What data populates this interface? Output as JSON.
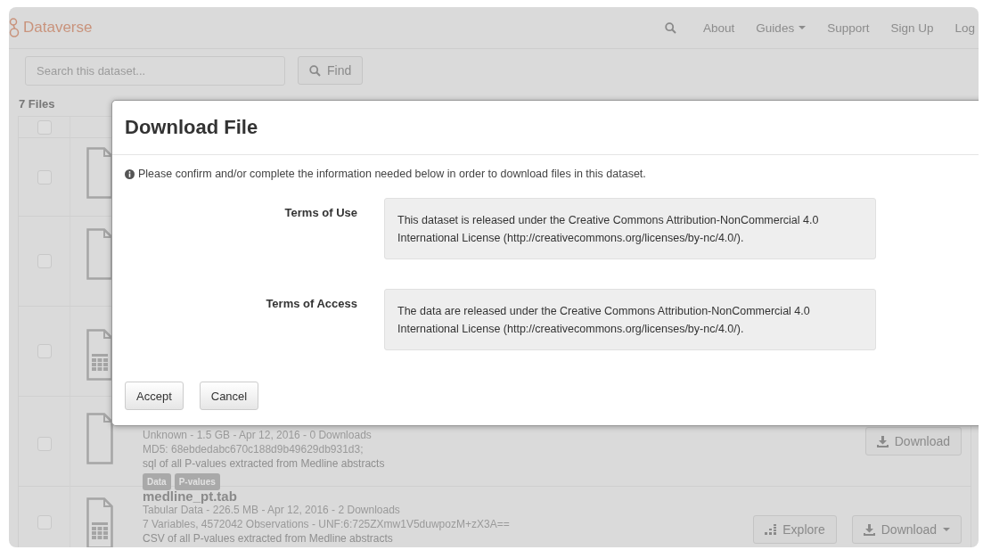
{
  "navbar": {
    "brand": "Dataverse",
    "links": [
      {
        "label": "About",
        "dropdown": false
      },
      {
        "label": "Guides",
        "dropdown": true
      },
      {
        "label": "Support",
        "dropdown": false
      },
      {
        "label": "Sign Up",
        "dropdown": false
      },
      {
        "label": "Log",
        "dropdown": false
      }
    ]
  },
  "search": {
    "placeholder": "Search this dataset...",
    "button": "Find"
  },
  "file_count": "7 Files",
  "header_checked": false,
  "files": [
    {
      "kind": "file",
      "checked": false
    },
    {
      "kind": "file",
      "checked": false
    },
    {
      "kind": "table",
      "checked": false
    },
    {
      "kind": "file",
      "checked": false,
      "meta": "Unknown - 1.5 GB - Apr 12, 2016 - 0 Downloads",
      "checksum": "MD5: 68ebdedabc670c188d9b49629db931d3;",
      "description": "sql of all P-values extracted from Medline abstracts",
      "tags": [
        "Data",
        "P-values"
      ],
      "buttons": [
        {
          "kind": "download",
          "label": "Download",
          "dropdown": false
        }
      ]
    },
    {
      "kind": "table",
      "checked": false,
      "name": "medline_pt.tab",
      "meta": "Tabular Data - 226.5 MB - Apr 12, 2016 - 2 Downloads",
      "checksum": "7 Variables, 4572042 Observations - UNF:6:725ZXmw1V5duwpozM+zX3A==",
      "description": "CSV of all P-values extracted from Medline abstracts",
      "buttons": [
        {
          "kind": "explore",
          "label": "Explore",
          "dropdown": false
        },
        {
          "kind": "download",
          "label": "Download",
          "dropdown": true
        }
      ]
    }
  ],
  "modal": {
    "title": "Download File",
    "notice": "Please confirm and/or complete the information needed below in order to download files in this dataset.",
    "terms": [
      {
        "label": "Terms of Use",
        "text": "This dataset is released under the Creative Commons Attribution-NonCommercial 4.0 International License (http://creativecommons.org/licenses/by-nc/4.0/)."
      },
      {
        "label": "Terms of Access",
        "text": "The data are released under the Creative Commons Attribution-NonCommercial 4.0 International License (http://creativecommons.org/licenses/by-nc/4.0/)."
      }
    ],
    "buttons": [
      "Accept",
      "Cancel"
    ]
  }
}
